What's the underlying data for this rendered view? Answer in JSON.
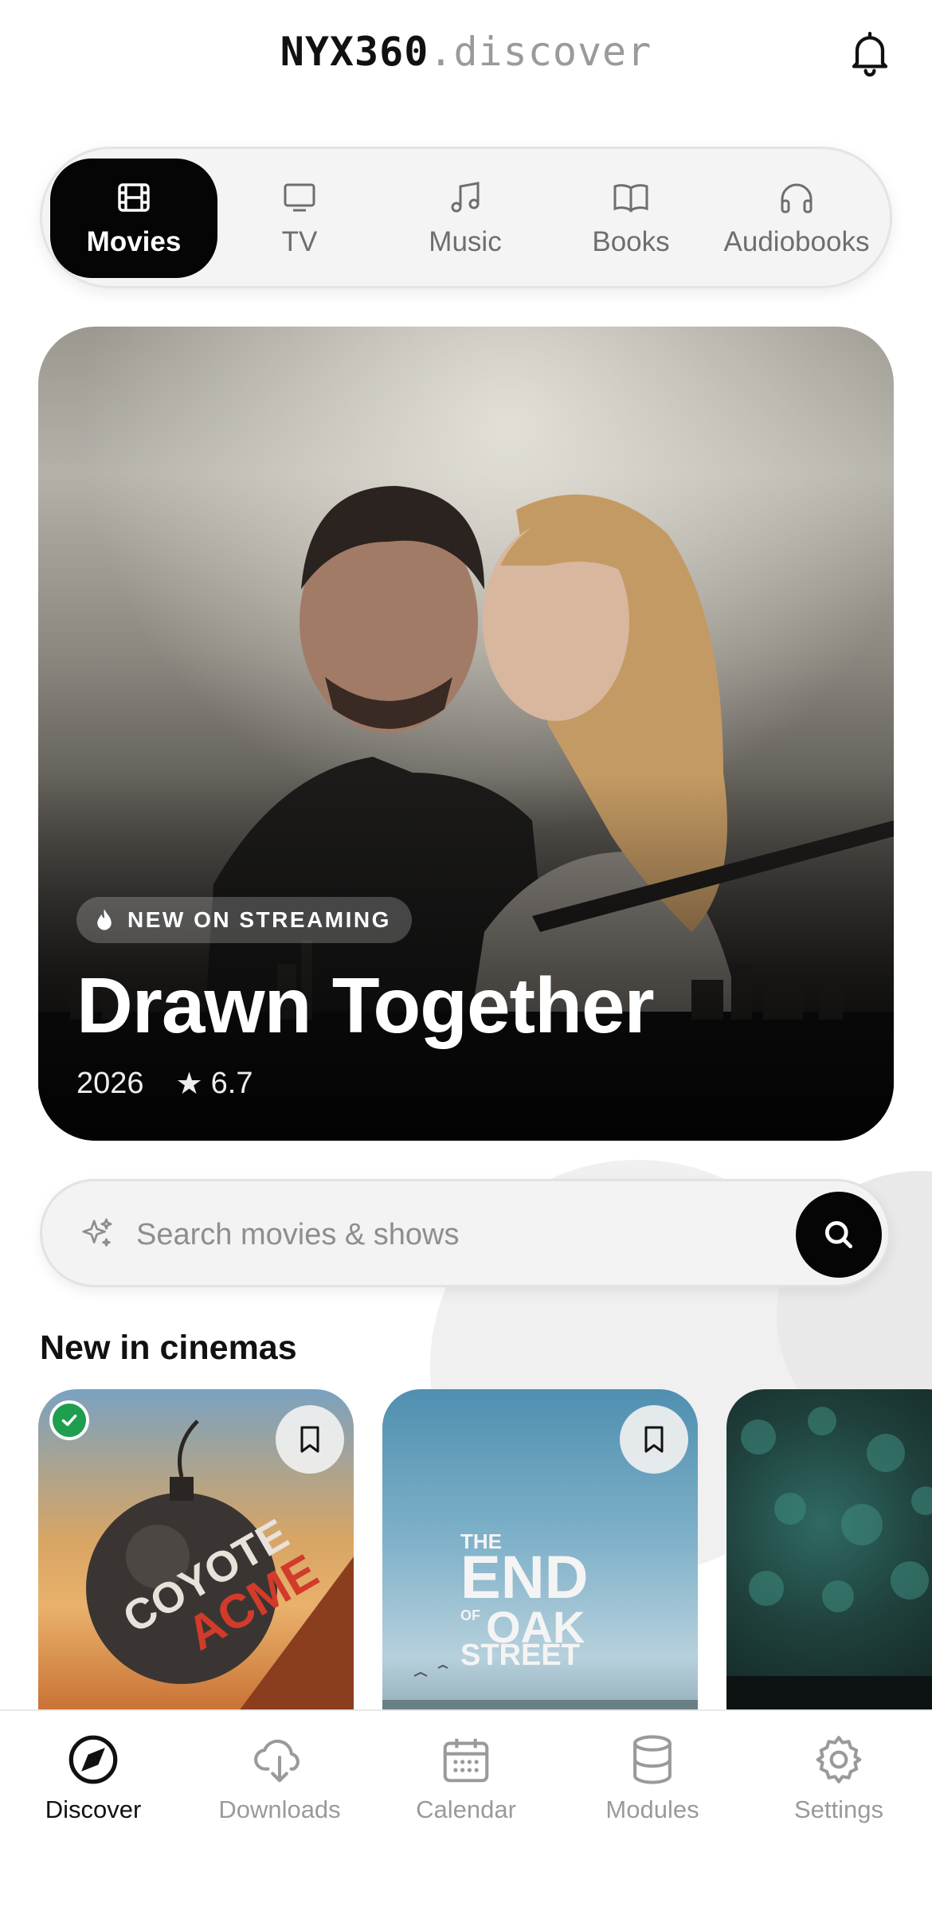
{
  "header": {
    "brand_bold": "NYX360",
    "brand_light": ".discover"
  },
  "categories": [
    {
      "label": "Movies",
      "icon": "film-icon",
      "active": true
    },
    {
      "label": "TV",
      "icon": "tv-icon",
      "active": false
    },
    {
      "label": "Music",
      "icon": "music-note-icon",
      "active": false
    },
    {
      "label": "Books",
      "icon": "book-icon",
      "active": false
    },
    {
      "label": "Audiobooks",
      "icon": "headphones-icon",
      "active": false
    }
  ],
  "hero": {
    "badge": "NEW ON STREAMING",
    "title": "Drawn Together",
    "year": "2026",
    "rating": "6.7"
  },
  "search": {
    "placeholder": "Search movies & shows"
  },
  "section": {
    "title": "New in cinemas"
  },
  "posters": [
    {
      "title_art": "COYOTE vs. ACME",
      "watched": true,
      "bookmark_icon": "bookmark-icon"
    },
    {
      "title_art": "THE END OF OAK STREET",
      "watched": false,
      "bookmark_icon": "bookmark-icon"
    },
    {
      "title_art": "",
      "watched": false
    }
  ],
  "tabbar": [
    {
      "label": "Discover",
      "icon": "compass-icon",
      "active": true
    },
    {
      "label": "Downloads",
      "icon": "cloud-download-icon",
      "active": false
    },
    {
      "label": "Calendar",
      "icon": "calendar-icon",
      "active": false
    },
    {
      "label": "Modules",
      "icon": "database-icon",
      "active": false
    },
    {
      "label": "Settings",
      "icon": "gear-icon",
      "active": false
    }
  ],
  "colors": {
    "accent": "#050505",
    "inactive": "#9a9a9a",
    "watched_badge": "#1e9e4e"
  }
}
